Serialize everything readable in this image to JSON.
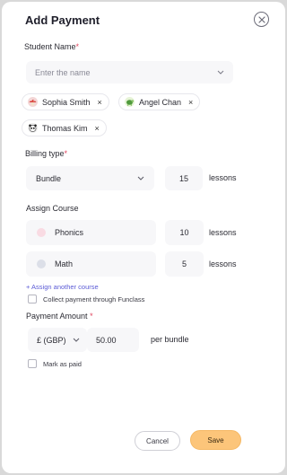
{
  "modal": {
    "title": "Add Payment"
  },
  "student": {
    "label": "Student Name",
    "required_mark": "*",
    "placeholder": "Enter the name",
    "chips": [
      {
        "name": "Sophia Smith",
        "avatar_icon": "mushroom-avatar-icon"
      },
      {
        "name": "Angel Chan",
        "avatar_icon": "turtle-avatar-icon"
      },
      {
        "name": "Thomas Kim",
        "avatar_icon": "panda-avatar-icon"
      }
    ],
    "remove_glyph": "×"
  },
  "billing": {
    "label": "Billing type",
    "required_mark": "*",
    "type_value": "Bundle",
    "lessons_value": "15",
    "lessons_suffix": "lessons"
  },
  "course": {
    "label": "Assign Course",
    "items": [
      {
        "name": "Phonics",
        "lessons": "10",
        "suffix": "lessons",
        "dot_color": "#f9dbe3"
      },
      {
        "name": "Math",
        "lessons": "5",
        "suffix": "lessons",
        "dot_color": "#dcdfe8"
      }
    ],
    "add_link": "+ Assign another course"
  },
  "collect_checkbox": {
    "label": "Collect payment through Funclass",
    "checked": false
  },
  "payment": {
    "label": "Payment Amount",
    "required_mark": "*",
    "currency": "£ (GBP)",
    "amount": "50.00",
    "suffix": "per bundle"
  },
  "paid_checkbox": {
    "label": "Mark as paid",
    "checked": false
  },
  "actions": {
    "cancel": "Cancel",
    "save": "Save"
  },
  "colors": {
    "accent": "#fcc57a",
    "link": "#5b5bd6",
    "required": "#e0455f"
  }
}
